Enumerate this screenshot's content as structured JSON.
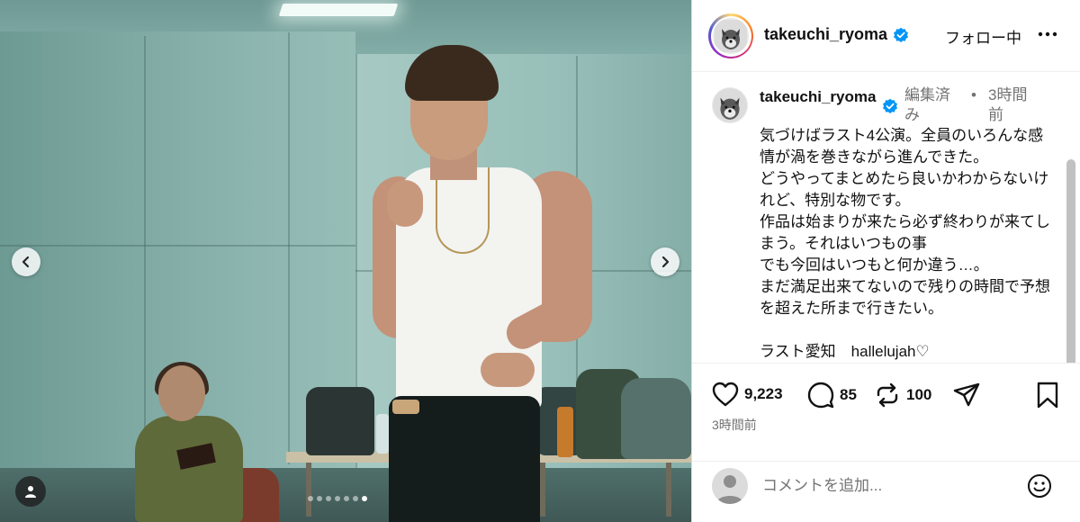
{
  "post": {
    "username": "takeuchi_ryoma",
    "follow_label": "フォロー中",
    "carousel": {
      "slides": 7,
      "active_index": 6
    }
  },
  "caption": {
    "username": "takeuchi_ryoma",
    "edited_label": "編集済み",
    "separator": "•",
    "time": "3時間前",
    "text": "気づけばラスト4公演。全員のいろんな感情が渦を巻きながら進んできた。\nどうやってまとめたら良いかわからないけれど、特別な物です。\n作品は始まりが来たら必ず終わりが来てしまう。それはいつもの事\nでも今回はいつもと何か違う…。\nまだ満足出来てないので残りの時間で予想を超えた所まで行きたい。\n\nラスト愛知　hallelujah♡"
  },
  "actions": {
    "likes": "9,223",
    "comments": "85",
    "reposts": "100",
    "posted_time": "3時間前"
  },
  "comment_box": {
    "placeholder": "コメントを追加..."
  },
  "icons": {
    "verified": "verified-badge-icon",
    "more": "more-options-icon",
    "like": "heart-icon",
    "comment": "comment-bubble-icon",
    "repost": "repost-icon",
    "share": "send-icon",
    "save": "bookmark-icon",
    "emoji": "emoji-icon",
    "prev": "chevron-left-icon",
    "next": "chevron-right-icon",
    "tags": "user-tag-icon"
  },
  "colors": {
    "verified": "#0095f6",
    "secondary_text": "#737373",
    "primary_text": "#111111"
  }
}
